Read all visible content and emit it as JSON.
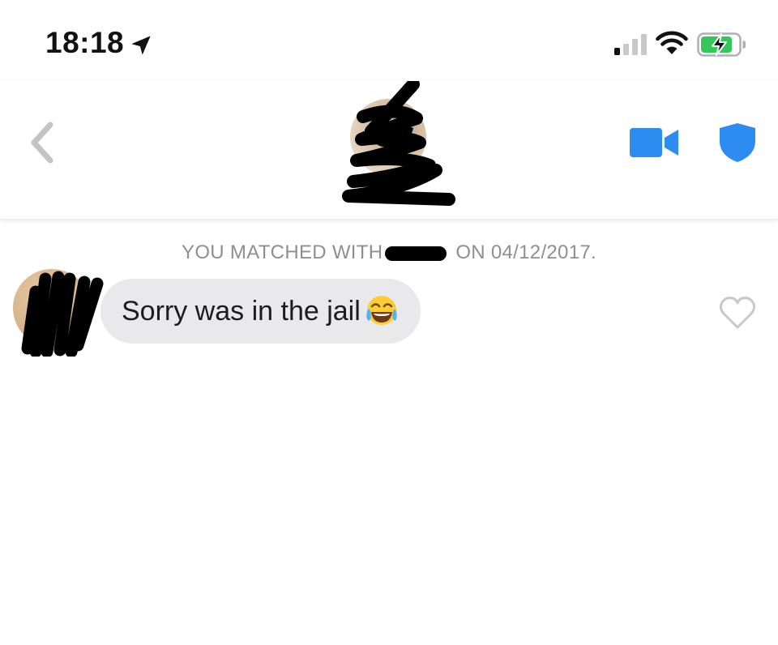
{
  "status_bar": {
    "time": "18:18",
    "icons": [
      "location-arrow-icon",
      "cellular-signal-icon",
      "wifi-icon",
      "battery-charging-icon"
    ],
    "battery_color": "#34c759",
    "signal_bars_active": 1,
    "signal_bars_total": 4
  },
  "header": {
    "back_icon": "chevron-left-icon",
    "video_icon": "video-camera-icon",
    "shield_icon": "shield-icon",
    "accent_color": "#2d8cf0"
  },
  "conversation": {
    "match_notice_before": "YOU MATCHED WITH",
    "match_notice_after": "ON 04/12/2017.",
    "messages": [
      {
        "text": "Sorry was in the jail",
        "emoji": "😂",
        "emoji_icon": "face-with-tears-of-joy-emoji",
        "like_icon": "heart-outline-icon"
      }
    ]
  }
}
